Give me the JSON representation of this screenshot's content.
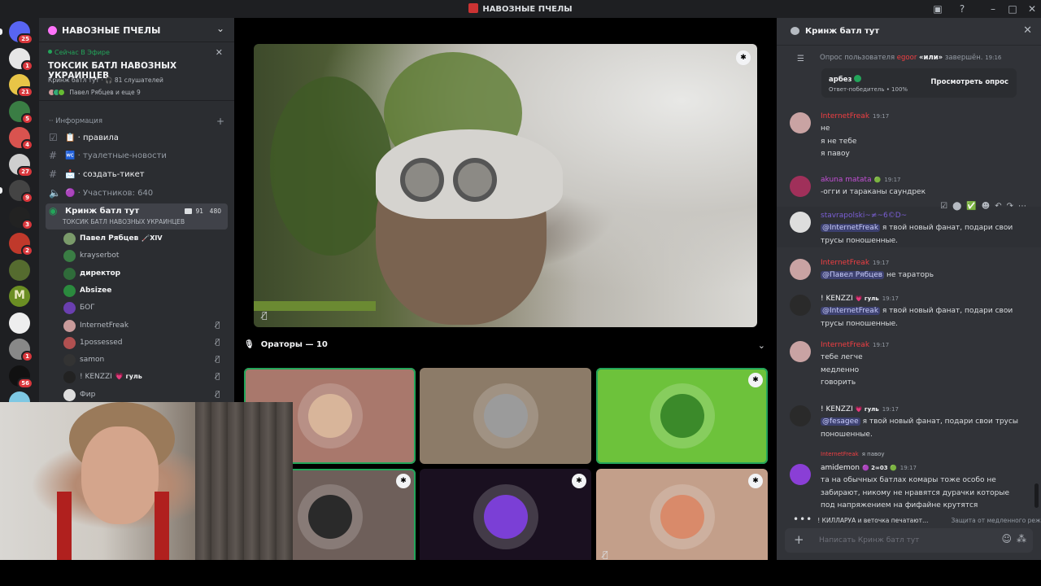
{
  "window": {
    "title": "НАВОЗНЫЕ ПЧЕЛЫ",
    "controls": [
      "inbox-icon",
      "help-icon",
      "minimize-icon",
      "maximize-icon",
      "close-icon"
    ]
  },
  "servers": [
    {
      "badge": "25",
      "color": "#5865f2"
    },
    {
      "badge": "1",
      "color": "#e6e6e6"
    },
    {
      "badge": "21",
      "color": "#e8c547"
    },
    {
      "badge": "5",
      "color": "#3a7d44"
    },
    {
      "badge": "4",
      "color": "#d9534f"
    },
    {
      "badge": "27",
      "color": "#cfcfcf"
    },
    {
      "badge": "9",
      "color": "#444"
    },
    {
      "badge": "3",
      "color": "#222"
    },
    {
      "badge": "2",
      "color": "#c0392b"
    },
    {
      "badge": "",
      "color": "#556b2f"
    },
    {
      "badge": "",
      "color": "#6b8e23",
      "letter": "M"
    },
    {
      "badge": "",
      "color": "#eeeeee"
    },
    {
      "badge": "1",
      "color": "#888"
    },
    {
      "badge": "56",
      "color": "#111"
    },
    {
      "badge": "",
      "color": "#7ec8e3"
    }
  ],
  "sidebar": {
    "server_name": "НАВОЗНЫЕ ПЧЕЛЫ",
    "live": {
      "on_air": "Сейчас В Эфире",
      "title": "ТОКСИК БАТЛ НАВОЗНЫХ УКРАИНЦЕВ",
      "meta": "Кринж батл тут · 🎧 81 слушателей",
      "people": "Павел Рябцев и еще 9"
    },
    "category": "Информация",
    "channels": [
      {
        "icon": "rules-icon",
        "label": "📋 · правила",
        "unread": true
      },
      {
        "icon": "hash-icon",
        "label": "🚾 · туалетные-новости",
        "unread": false
      },
      {
        "icon": "hash-icon",
        "label": "📩 · создать-тикет",
        "unread": true
      },
      {
        "icon": "stage-icon",
        "label": "🟣 · Участников: 640",
        "unread": false
      }
    ],
    "stage_channel": {
      "label": "Кринж батл тут",
      "sub": "ТОКСИК БАТЛ НАВОЗНЫХ УКРАИНЦЕВ",
      "video_count": "91",
      "listeners": "480"
    },
    "members": [
      {
        "name": "Павел Рябцев",
        "extra": "🦯XIV",
        "bold": true,
        "color": "#7a9a6a",
        "muted": false
      },
      {
        "name": "krayserbot",
        "extra": "",
        "bold": false,
        "color": "#3a7d44",
        "muted": false
      },
      {
        "name": "директор",
        "extra": "",
        "bold": true,
        "color": "#2f6b3a",
        "muted": false
      },
      {
        "name": "Absizee",
        "extra": "",
        "bold": true,
        "color": "#2b8a3e",
        "muted": false
      },
      {
        "name": "БОГ",
        "extra": "",
        "bold": false,
        "color": "#6a3fb0",
        "muted": false
      },
      {
        "name": "InternetFreak",
        "extra": "",
        "bold": false,
        "color": "#c99b9b",
        "muted": true
      },
      {
        "name": "1possessed",
        "extra": "",
        "bold": false,
        "color": "#b05050",
        "muted": true
      },
      {
        "name": "samon",
        "extra": "",
        "bold": false,
        "color": "#333",
        "muted": true
      },
      {
        "name": "! KENZZI",
        "extra": "💗 гуль",
        "bold": false,
        "color": "#222",
        "muted": true
      },
      {
        "name": "Фир",
        "extra": "",
        "bold": false,
        "color": "#ddd",
        "muted": true
      }
    ]
  },
  "stage": {
    "speakers_label": "Ораторы — 10",
    "tiles": [
      {
        "bg": "#a9786c",
        "avatar": "#d8b59a",
        "speaking": true,
        "shield": false,
        "camoff": false
      },
      {
        "bg": "#8c7b68",
        "avatar": "#9b9b9b",
        "speaking": false,
        "shield": false,
        "camoff": false
      },
      {
        "bg": "#6dc23b",
        "avatar": "#3b8a2a",
        "speaking": true,
        "shield": true,
        "camoff": false
      },
      {
        "bg": "#6e5f5a",
        "avatar": "#2a2a2a",
        "speaking": true,
        "shield": true,
        "camoff": false
      },
      {
        "bg": "#1a1020",
        "avatar": "#7b3fd6",
        "speaking": false,
        "shield": true,
        "camoff": false
      },
      {
        "bg": "#c39f8a",
        "avatar": "#d98a6a",
        "speaking": false,
        "shield": true,
        "camoff": true
      }
    ]
  },
  "chat": {
    "channel": "Кринж батл тут",
    "poll": {
      "prefix": "Опрос пользователя",
      "user": "egoor",
      "quote": "«или»",
      "suffix": "завершён.",
      "time": "19:16",
      "answer": "арбез",
      "winner": "Ответ-победитель • 100%",
      "button": "Просмотреть опрос"
    },
    "messages": [
      {
        "author": "InternetFreak",
        "color": "#f23f43",
        "tag": "",
        "time": "19:17",
        "avatar": "#c9a3a3",
        "lines": [
          "не",
          "я не тебе",
          "я павоу"
        ]
      },
      {
        "author": "akuna matata",
        "color": "#c44fd6",
        "tag": "🟢",
        "time": "19:17",
        "avatar": "#a0305a",
        "lines": [
          "-огги и тараканы саундрек"
        ]
      },
      {
        "author": "stavrapolski~≠~6©D~",
        "color": "#7b5fd6",
        "tag": "",
        "time": "",
        "avatar": "#dddddd",
        "mention": "@InternetFreak",
        "lines": [
          " я твой новый фанат, подари свои",
          "трусы поношенные."
        ]
      },
      {
        "author": "InternetFreak",
        "color": "#f23f43",
        "tag": "",
        "time": "19:17",
        "avatar": "#c9a3a3",
        "mention": "@Павел Рябцев",
        "lines": [
          " не тараторь"
        ]
      },
      {
        "author": "! KENZZI",
        "color": "#f2f3f5",
        "tag": "💗 гуль",
        "time": "19:17",
        "avatar": "#2a2a2a",
        "mention": "@InternetFreak",
        "lines": [
          " я твой новый фанат, подари свои",
          "трусы поношенные."
        ]
      },
      {
        "author": "InternetFreak",
        "color": "#f23f43",
        "tag": "",
        "time": "19:17",
        "avatar": "#c9a3a3",
        "lines": [
          "тебе легче",
          "медленно",
          "говорить"
        ]
      },
      {
        "author": "! KENZZI",
        "color": "#f2f3f5",
        "tag": "💗 гуль",
        "time": "19:17",
        "avatar": "#2a2a2a",
        "mention": "@fesagee",
        "lines": [
          " я твой новый фанат, подари свои трусы",
          "поношенные."
        ]
      },
      {
        "author": "amidemon",
        "color": "#f2f3f5",
        "tag": "🟣 2∞03 🟢",
        "time": "19:17",
        "avatar": "#8a3fd6",
        "reply_to": "InternetFreak",
        "reply_text": "я павоу",
        "lines": [
          "та на обычных батлах комары тоже особо не",
          "забирают, никому не нравятся дурачки которые",
          "под напряжением на фифайне крутятся"
        ]
      }
    ],
    "typing": "! КИЛЛАРУА и веточка печатают…",
    "slowmode": "Защита от медленного режима",
    "composer_placeholder": "Написать Кринж батл тут"
  }
}
